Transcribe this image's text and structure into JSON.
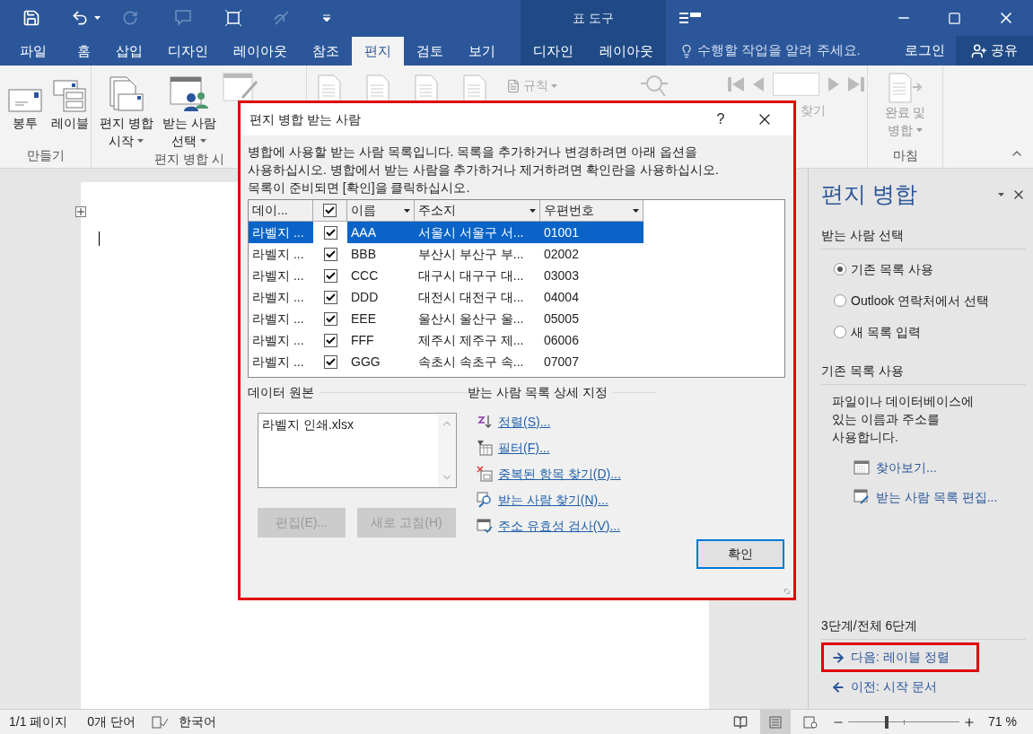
{
  "title_bar": {
    "context_title": "표 도구"
  },
  "tabs": [
    {
      "label": "파일",
      "selected": false
    },
    {
      "label": "홈",
      "selected": false
    },
    {
      "label": "삽입",
      "selected": false
    },
    {
      "label": "디자인",
      "selected": false
    },
    {
      "label": "레이아웃",
      "selected": false
    },
    {
      "label": "참조",
      "selected": false
    },
    {
      "label": "편지",
      "selected": true
    },
    {
      "label": "검토",
      "selected": false
    },
    {
      "label": "보기",
      "selected": false
    }
  ],
  "context_tabs": [
    {
      "label": "디자인"
    },
    {
      "label": "레이아웃"
    }
  ],
  "tell_me": {
    "placeholder": "수행할 작업을 알려 주세요."
  },
  "sign_in": "로그인",
  "share": "공유",
  "ribbon": {
    "groups": [
      {
        "label": "만들기",
        "buttons": [
          {
            "kind": "envelope",
            "lines": [
              "봉투"
            ]
          },
          {
            "kind": "labels",
            "lines": [
              "레이블"
            ]
          }
        ]
      },
      {
        "label": "편지 병합 시",
        "buttons": [
          {
            "kind": "start",
            "lines": [
              "편지 병합",
              "시작"
            ],
            "dropdown": true
          },
          {
            "kind": "recipients",
            "lines": [
              "받는 사람",
              "선택"
            ],
            "dropdown": true
          }
        ]
      }
    ],
    "rules": "규칙",
    "find": "찾기",
    "finish": {
      "label": "마침",
      "lines": [
        "완료 및",
        "병합"
      ],
      "dropdown": true
    }
  },
  "dialog": {
    "title": "편지 병합 받는 사람",
    "help": "?",
    "intro": [
      "병합에 사용할 받는 사람 목록입니다. 목록을 추가하거나 변경하려면 아래 옵션을",
      "사용하십시오. 병합에서 받는 사람을 추가하거나 제거하려면 확인란을 사용하십시오.",
      "목록이 준비되면 [확인]을 클릭하십시오."
    ],
    "columns": [
      {
        "kind": "text",
        "label": "데이...",
        "dropdown": false
      },
      {
        "kind": "check",
        "checked": true
      },
      {
        "kind": "text",
        "label": "이름",
        "dropdown": true
      },
      {
        "kind": "text",
        "label": "주소지",
        "dropdown": true
      },
      {
        "kind": "text",
        "label": "우편번호",
        "dropdown": true
      }
    ],
    "rows": [
      {
        "source": "라벨지 ...",
        "checked": true,
        "name": "AAA",
        "address": "서울시 서울구 서...",
        "zip": "01001",
        "selected": true
      },
      {
        "source": "라벨지 ...",
        "checked": true,
        "name": "BBB",
        "address": "부산시 부산구 부...",
        "zip": "02002",
        "selected": false
      },
      {
        "source": "라벨지 ...",
        "checked": true,
        "name": "CCC",
        "address": "대구시 대구구 대...",
        "zip": "03003",
        "selected": false
      },
      {
        "source": "라벨지 ...",
        "checked": true,
        "name": "DDD",
        "address": "대전시 대전구 대...",
        "zip": "04004",
        "selected": false
      },
      {
        "source": "라벨지 ...",
        "checked": true,
        "name": "EEE",
        "address": "울산시 울산구 울...",
        "zip": "05005",
        "selected": false
      },
      {
        "source": "라벨지 ...",
        "checked": true,
        "name": "FFF",
        "address": "제주시 제주구 제...",
        "zip": "06006",
        "selected": false
      },
      {
        "source": "라벨지 ...",
        "checked": true,
        "name": "GGG",
        "address": "속초시 속초구 속...",
        "zip": "07007",
        "selected": false
      }
    ],
    "data_source": {
      "heading": "데이터 원본",
      "items": [
        "라벨지 인쇄.xlsx"
      ],
      "buttons": [
        {
          "label": "편집(E)...",
          "disabled": true
        },
        {
          "label": "새로 고침(H)",
          "disabled": true
        }
      ]
    },
    "refine": {
      "heading": "받는 사람 목록 상세 지정",
      "links": [
        {
          "kind": "sort",
          "label": "정렬(S)..."
        },
        {
          "kind": "filter",
          "label": "필터(F)..."
        },
        {
          "kind": "duplicates",
          "label": "중복된 항목 찾기(D)..."
        },
        {
          "kind": "find",
          "label": "받는 사람 찾기(N)..."
        },
        {
          "kind": "validate",
          "label": "주소 유효성 검사(V)..."
        }
      ]
    },
    "ok": "확인"
  },
  "task_pane": {
    "title": "편지 병합",
    "section1": "받는 사람 선택",
    "radios": [
      {
        "label": "기존 목록 사용",
        "selected": true
      },
      {
        "label": "Outlook 연락처에서 선택",
        "selected": false
      },
      {
        "label": "새 목록 입력",
        "selected": false
      }
    ],
    "section2": "기존 목록 사용",
    "description": [
      "파일이나 데이터베이스에",
      "있는 이름과 주소를",
      "사용합니다."
    ],
    "links": [
      {
        "kind": "browse",
        "label": "찾아보기..."
      },
      {
        "kind": "edit",
        "label": "받는 사람 목록 편집..."
      }
    ],
    "step": "3단계/전체 6단계",
    "next": {
      "label": "다음: 레이블 정렬",
      "highlighted": true
    },
    "previous": {
      "label": "이전: 시작 문서",
      "highlighted": false
    }
  },
  "status_bar": {
    "page": "1/1 페이지",
    "words": "0개 단어",
    "language": "한국어",
    "zoom": "71 %",
    "zoom_slider": {
      "level": 0.35
    }
  }
}
